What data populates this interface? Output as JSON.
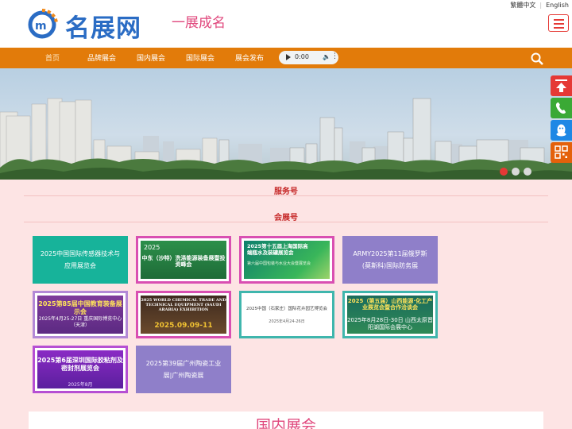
{
  "header": {
    "logo_text": "名展网",
    "slogan": "一展成名",
    "lang_traditional": "繁體中文",
    "lang_english": "English"
  },
  "nav": {
    "items": [
      "首页",
      "品牌展会",
      "国内展会",
      "国际展会",
      "展会发布"
    ],
    "audio_time": "0:00"
  },
  "sections": {
    "service": "服务号",
    "expo": "会展号"
  },
  "cards": [
    {
      "type": "text",
      "bg": "#17b39a",
      "text": "2025中国国际传感器技术与应用展览会"
    },
    {
      "type": "image",
      "title": "中东（沙特）洗涤能源装备展暨投资峰会",
      "sub": "2025",
      "theme": "green"
    },
    {
      "type": "image",
      "title": "2025第十五届上海国际高端瓶水及装罐展览会",
      "sub": "第六届中国包装与水业大会暨展览会",
      "theme": "teal"
    },
    {
      "type": "text",
      "bg": "#8f7fc9",
      "text": "ARMY2025第11届俄罗斯(莫斯科)国际防务展"
    },
    {
      "type": "image",
      "title": "2025第85届中国教育装备展示会",
      "sub": "2025年4月25-27日 重庆国际博览中心（天津）",
      "theme": "purple"
    },
    {
      "type": "image",
      "title": "2025 WORLD CHEMICAL TRADE AND TECHNICAL EQUIPMENT (SAUDI ARABIA) EXHIBITION",
      "sub": "2025.09.09-11",
      "theme": "brown"
    },
    {
      "type": "image",
      "title": "2025中国（石家庄）国际花卉园艺博览会",
      "sub": "2025年4月24-26日",
      "theme": "white"
    },
    {
      "type": "image",
      "title": "2025（第五届）山西能源·化工产业展览会暨合作洽谈会",
      "sub": "2025年8月28日-30日 山西太原晋阳湖国际会展中心",
      "theme": "darkgreen"
    },
    {
      "type": "image",
      "title": "2025第6届深圳国际胶粘剂及密封剂展览会",
      "sub": "2025年8月",
      "theme": "violet"
    },
    {
      "type": "text",
      "bg": "#8f7fc9",
      "text": "2025第39届广州陶瓷工业展|广州陶瓷展"
    }
  ],
  "domestic": {
    "title": "国内展会"
  },
  "colors": {
    "nav": "#e27b0a",
    "accent_red": "#c62828",
    "pink": "#e0487d",
    "logo_blue": "#2a6cc4",
    "page_bg": "#fde4e4"
  },
  "icons": [
    "menu-icon",
    "play-icon",
    "volume-icon",
    "more-icon",
    "search-icon",
    "back-to-top-icon",
    "phone-icon",
    "qq-icon",
    "qrcode-icon"
  ]
}
